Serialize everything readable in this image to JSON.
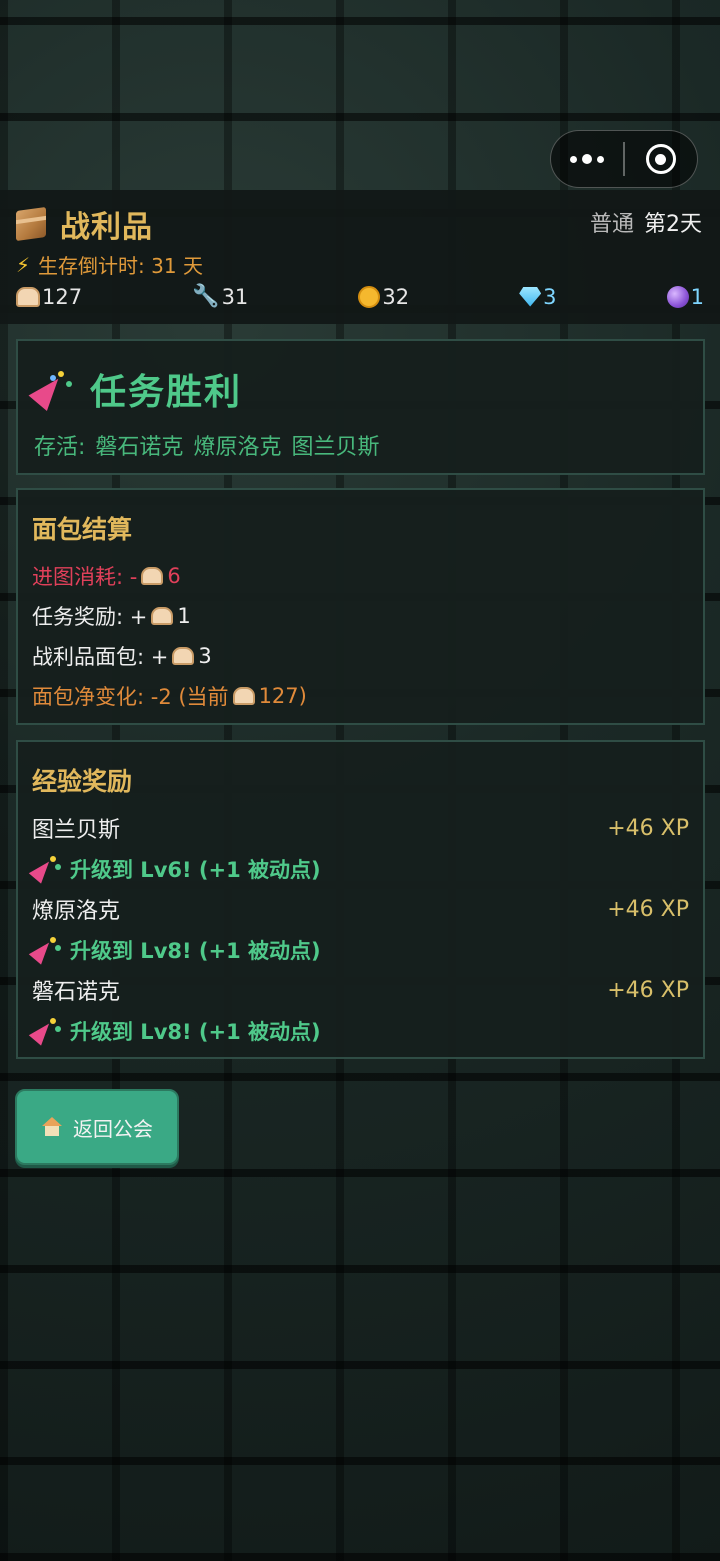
{
  "capsule": {
    "more_icon": "more-dots-icon",
    "close_icon": "target-close-icon"
  },
  "header": {
    "title": "战利品",
    "title_icon": "box-icon",
    "difficulty": "普通",
    "day": "第2天",
    "countdown_icon": "lightning-icon",
    "countdown": "生存倒计时: 31 天",
    "resources": [
      {
        "icon": "bread-icon",
        "value": "127"
      },
      {
        "icon": "wrench-icon",
        "value": "31"
      },
      {
        "icon": "coin-icon",
        "value": "32"
      },
      {
        "icon": "gem-icon",
        "value": "3"
      },
      {
        "icon": "orb-icon",
        "value": "1"
      }
    ]
  },
  "victory": {
    "icon": "party-popper-icon",
    "title": "任务胜利",
    "survivors_label": "存活:",
    "survivors": [
      "磐石诺克",
      "燎原洛克",
      "图兰贝斯"
    ]
  },
  "bread": {
    "title": "面包结算",
    "entry_cost_label": "进图消耗: -",
    "entry_cost_value": "6",
    "mission_reward_label": "任务奖励: +",
    "mission_reward_value": "1",
    "loot_bread_label": "战利品面包: +",
    "loot_bread_value": "3",
    "net_change_label": "面包净变化: -2 (当前 ",
    "net_change_value": "127)"
  },
  "xp": {
    "title": "经验奖励",
    "heroes": [
      {
        "name": "图兰贝斯",
        "xp": "+46 XP",
        "levelup": "升级到 Lv6!  (+1 被动点)"
      },
      {
        "name": "燎原洛克",
        "xp": "+46 XP",
        "levelup": "升级到 Lv8!  (+1 被动点)"
      },
      {
        "name": "磐石诺克",
        "xp": "+46 XP",
        "levelup": "升级到 Lv8!  (+1 被动点)"
      }
    ]
  },
  "actions": {
    "return_label": "返回公会",
    "return_icon": "home-icon"
  },
  "colors": {
    "gold": "#e1b85c",
    "green": "#4fc98a",
    "red": "#e0405a",
    "orange": "#e08a3a",
    "button": "#3aa985"
  }
}
